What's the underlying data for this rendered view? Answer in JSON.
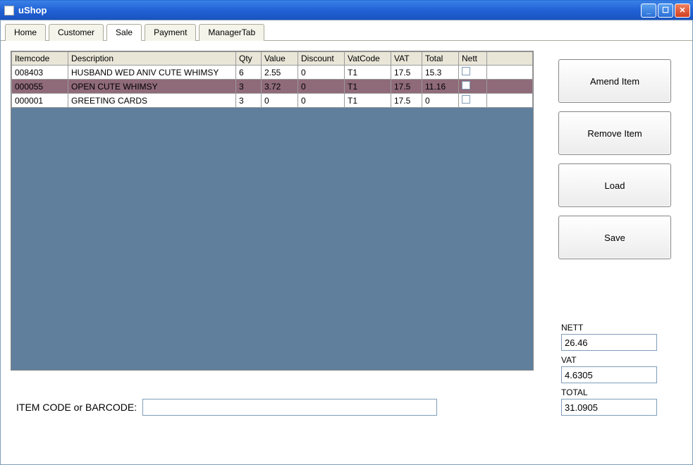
{
  "titlebar": {
    "app_title": "uShop"
  },
  "tabs": [
    {
      "label": "Home",
      "active": false
    },
    {
      "label": "Customer",
      "active": false
    },
    {
      "label": "Sale",
      "active": true
    },
    {
      "label": "Payment",
      "active": false
    },
    {
      "label": "ManagerTab",
      "active": false
    }
  ],
  "grid": {
    "columns": [
      "Itemcode",
      "Description",
      "Qty",
      "Value",
      "Discount",
      "VatCode",
      "VAT",
      "Total",
      "Nett",
      ""
    ],
    "rows": [
      {
        "selected": false,
        "cells": [
          "008403",
          "HUSBAND WED ANIV CUTE WHIMSY",
          "6",
          "2.55",
          "0",
          "T1",
          "17.5",
          "15.3"
        ]
      },
      {
        "selected": true,
        "cells": [
          "000055",
          "OPEN CUTE WHIMSY",
          "3",
          "3.72",
          "0",
          "T1",
          "17.5",
          "11.16"
        ]
      },
      {
        "selected": false,
        "cells": [
          "000001",
          "GREETING CARDS",
          "3",
          "0",
          "0",
          "T1",
          "17.5",
          "0"
        ]
      }
    ]
  },
  "buttons": {
    "amend": "Amend Item",
    "remove": "Remove Item",
    "load": "Load",
    "save": "Save"
  },
  "barcode": {
    "label": "ITEM CODE or BARCODE:",
    "value": ""
  },
  "totals": {
    "nett_label": "NETT",
    "nett_value": "26.46",
    "vat_label": "VAT",
    "vat_value": "4.6305",
    "total_label": "TOTAL",
    "total_value": "31.0905"
  }
}
